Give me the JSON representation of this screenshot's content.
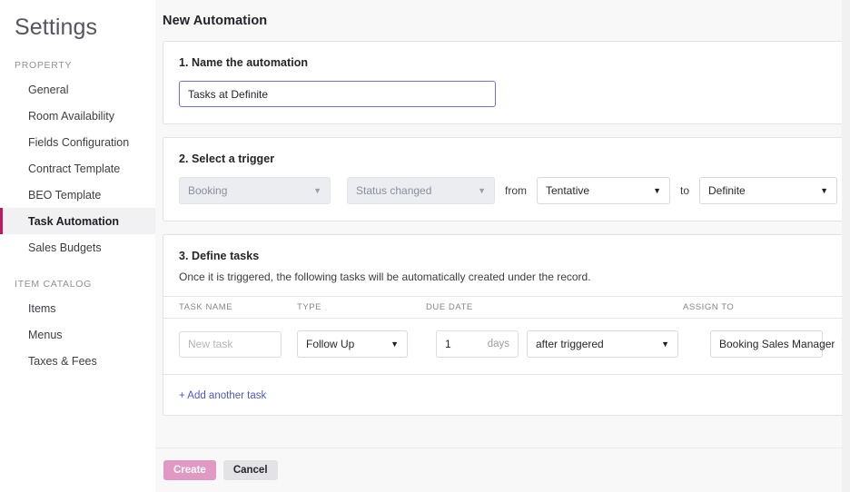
{
  "sidebar": {
    "title": "Settings",
    "groups": [
      {
        "label": "PROPERTY",
        "items": [
          {
            "label": "General",
            "active": false
          },
          {
            "label": "Room Availability",
            "active": false
          },
          {
            "label": "Fields Configuration",
            "active": false
          },
          {
            "label": "Contract Template",
            "active": false
          },
          {
            "label": "BEO Template",
            "active": false
          },
          {
            "label": "Task Automation",
            "active": true
          },
          {
            "label": "Sales Budgets",
            "active": false
          }
        ]
      },
      {
        "label": "ITEM CATALOG",
        "items": [
          {
            "label": "Items",
            "active": false
          },
          {
            "label": "Menus",
            "active": false
          },
          {
            "label": "Taxes & Fees",
            "active": false
          }
        ]
      }
    ],
    "active_accent": "#c2185b"
  },
  "page": {
    "title": "New Automation"
  },
  "step1": {
    "heading": "1. Name the automation",
    "name_value": "Tasks at Definite",
    "name_placeholder": "",
    "focus_border_color": "#6b74d4"
  },
  "step2": {
    "heading": "2. Select a trigger",
    "record_type": "Booking",
    "event_type": "Status changed",
    "from_label": "from",
    "from_value": "Tentative",
    "to_label": "to",
    "to_value": "Definite",
    "caret_glyph": "▼"
  },
  "step3": {
    "heading": "3. Define tasks",
    "description": "Once it is triggered, the following tasks will be automatically created under the record.",
    "columns": {
      "task_name": "TASK NAME",
      "type": "TYPE",
      "due_date": "DUE DATE",
      "assign_to": "ASSIGN TO"
    },
    "rows": [
      {
        "task_name_value": "",
        "task_name_placeholder": "New task",
        "type": "Follow Up",
        "due_number": "1",
        "due_units": "days",
        "due_when": "after triggered",
        "assign_to": "Booking Sales Manager",
        "delete_icon": "trash-icon"
      }
    ],
    "add_task_label": "+ Add another task"
  },
  "actions": {
    "create_label": "Create",
    "cancel_label": "Cancel",
    "create_color": "#e198c2",
    "cancel_color": "#e3e3e6"
  }
}
